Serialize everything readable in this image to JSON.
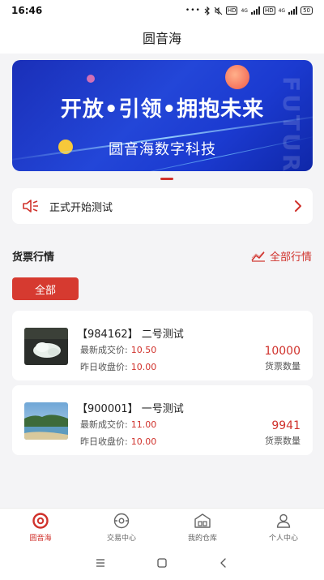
{
  "status_bar": {
    "time": "16:46",
    "battery": "50",
    "net_tag_1": "HD",
    "net_tag_2": "4G",
    "net_tag_3": "HD",
    "net_tag_4": "4G"
  },
  "header": {
    "title": "圆音海"
  },
  "banner": {
    "slogan": "开放•引领•拥抱未来",
    "company": "圆音海数字科技",
    "watermark": "FUTURE"
  },
  "notice": {
    "text": "正式开始测试"
  },
  "market": {
    "title": "货票行情",
    "all_link": "全部行情",
    "filter_label": "全部",
    "items": [
      {
        "title": "【984162】 二号测试",
        "latest_label": "最新成交价:",
        "latest_value": "10.50",
        "prev_label": "昨日收盘价:",
        "prev_value": "10.00",
        "qty": "10000",
        "qty_label": "货票数量"
      },
      {
        "title": "【900001】 一号测试",
        "latest_label": "最新成交价:",
        "latest_value": "11.00",
        "prev_label": "昨日收盘价:",
        "prev_value": "10.00",
        "qty": "9941",
        "qty_label": "货票数量"
      }
    ]
  },
  "bottom_nav": {
    "items": [
      {
        "label": "圆音海",
        "icon": "home-ring-icon",
        "active": true
      },
      {
        "label": "交易中心",
        "icon": "trade-icon",
        "active": false
      },
      {
        "label": "我的仓库",
        "icon": "warehouse-icon",
        "active": false
      },
      {
        "label": "个人中心",
        "icon": "profile-icon",
        "active": false
      }
    ]
  },
  "colors": {
    "accent": "#d0322c",
    "banner_blue": "#2346d8",
    "background": "#f4f4f6"
  }
}
